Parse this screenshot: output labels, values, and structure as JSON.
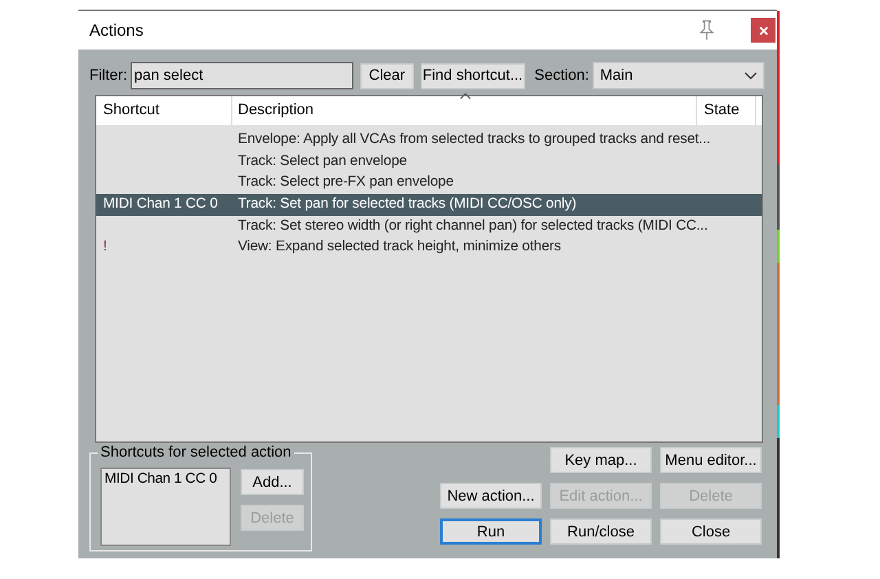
{
  "window": {
    "title": "Actions"
  },
  "filter": {
    "label": "Filter:",
    "value": "pan select"
  },
  "filter_buttons": [
    {
      "label": "Clear",
      "disabled": false
    },
    {
      "label": "Find shortcut...",
      "disabled": false
    }
  ],
  "section": {
    "label": "Section:",
    "value": "Main"
  },
  "table": {
    "columns": [
      "Shortcut",
      "Description",
      "State"
    ],
    "rows": [
      {
        "shortcut": "",
        "description": "Envelope: Apply all VCAs from selected tracks to grouped tracks and reset...",
        "selected": false
      },
      {
        "shortcut": "",
        "description": "Track: Select pan envelope",
        "selected": false
      },
      {
        "shortcut": "",
        "description": "Track: Select pre-FX pan envelope",
        "selected": false
      },
      {
        "shortcut": "MIDI Chan 1 CC 0",
        "description": "Track: Set pan for selected tracks (MIDI CC/OSC only)",
        "selected": true
      },
      {
        "shortcut": "",
        "description": "Track: Set stereo width (or right channel pan) for selected tracks (MIDI CC...",
        "selected": false
      },
      {
        "shortcut": "!",
        "color": "#8a1f52",
        "description": "View: Expand selected track height, minimize others",
        "selected": false
      }
    ]
  },
  "shortcuts_group": {
    "title": "Shortcuts for selected action",
    "items": [
      "MIDI Chan 1 CC 0"
    ],
    "buttons": [
      {
        "label": "Add...",
        "disabled": false
      },
      {
        "label": "Delete",
        "disabled": true
      }
    ]
  },
  "action_buttons": [
    [
      {
        "label": "Key map...",
        "disabled": false
      },
      {
        "label": "Menu editor...",
        "disabled": false
      }
    ],
    [
      {
        "label": "New action...",
        "disabled": false
      },
      {
        "label": "Edit action...",
        "disabled": true
      },
      {
        "label": "Delete",
        "disabled": true
      }
    ],
    [
      {
        "label": "Run",
        "disabled": false,
        "focused": true
      },
      {
        "label": "Run/close",
        "disabled": false
      },
      {
        "label": "Close",
        "disabled": false
      }
    ]
  ]
}
